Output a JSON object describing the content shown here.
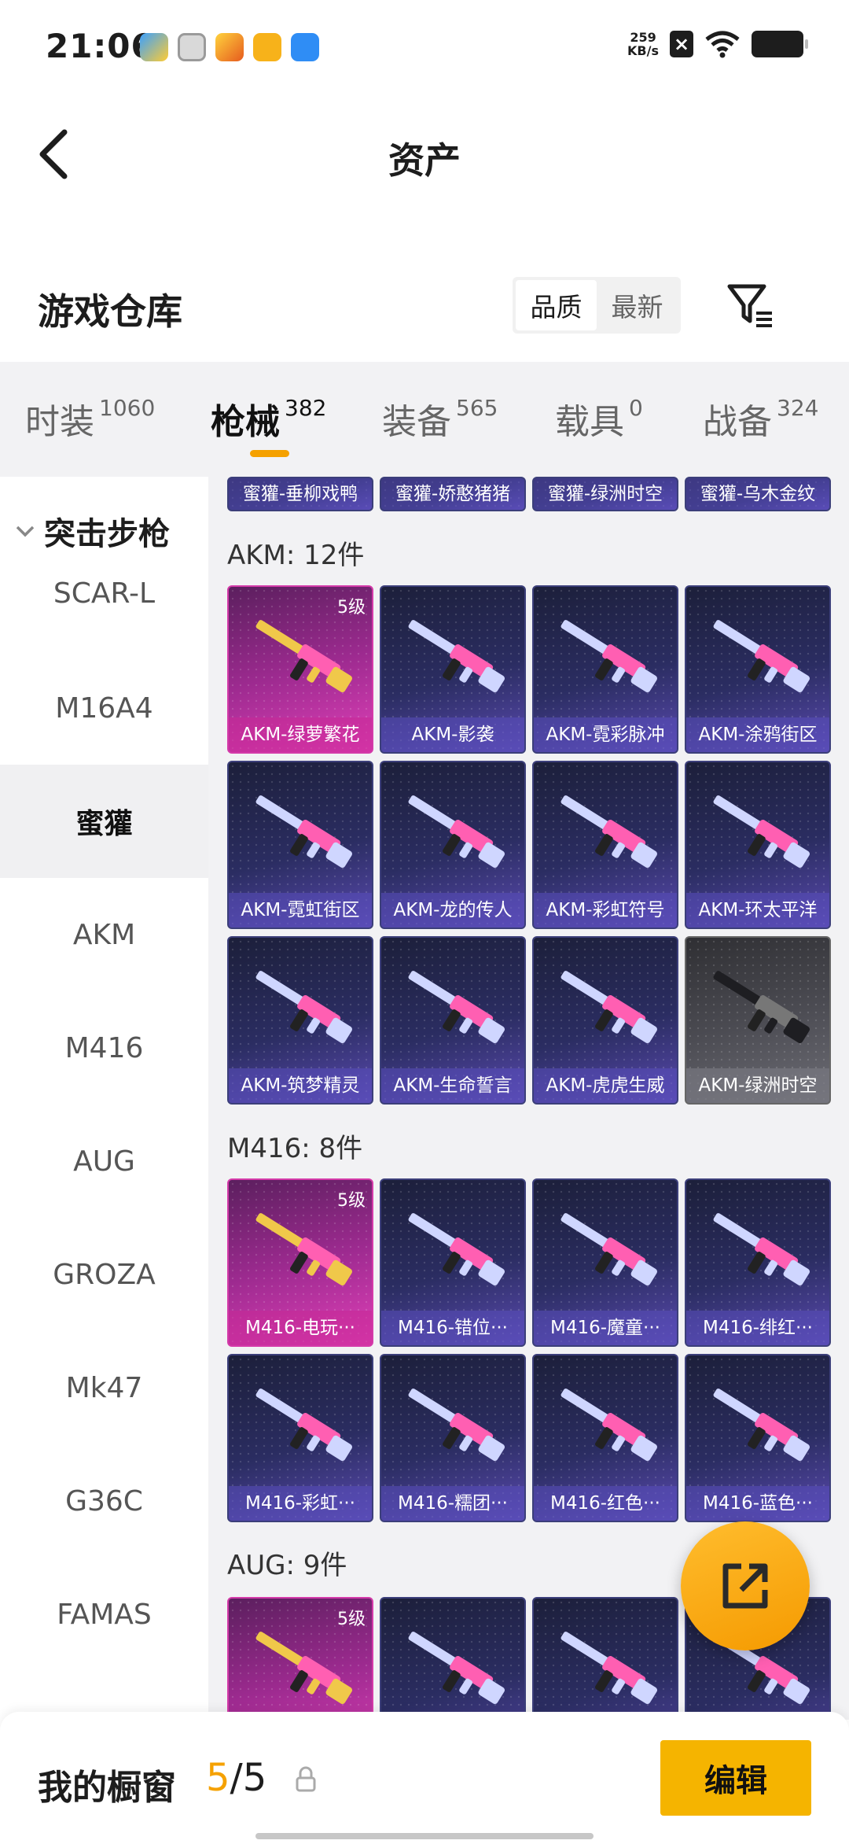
{
  "status_bar": {
    "time": "21:06",
    "speed_value": "259",
    "speed_unit": "KB/s",
    "app_icons": [
      "blue-app-icon",
      "gear-app-icon",
      "game-app-icon",
      "target-app-icon",
      "blue-bird-app-icon"
    ],
    "x_icon": "×"
  },
  "header": {
    "title": "资产",
    "back_icon": "back-arrow-icon"
  },
  "warehouse": {
    "title": "游戏仓库",
    "sort_options": [
      "品质",
      "最新"
    ],
    "sort_active": "品质",
    "filter_icon": "filter-icon"
  },
  "category_tabs": [
    {
      "label": "时装",
      "count": "1060"
    },
    {
      "label": "枪械",
      "count": "382",
      "active": true
    },
    {
      "label": "装备",
      "count": "565"
    },
    {
      "label": "载具",
      "count": "0"
    },
    {
      "label": "战备",
      "count": "324"
    }
  ],
  "sidebar": {
    "group": "突击步枪",
    "items": [
      "SCAR-L",
      "M16A4",
      "蜜獾",
      "AKM",
      "M416",
      "AUG",
      "GROZA",
      "Mk47",
      "G36C",
      "FAMAS"
    ],
    "active": "蜜獾"
  },
  "sections": {
    "top_row": [
      "蜜獾-垂柳戏鸭",
      "蜜獾-娇憨猪猪",
      "蜜獾-绿洲时空",
      "蜜獾-乌木金纹"
    ],
    "akm_title": "AKM: 12件",
    "akm": [
      {
        "name": "AKM-绿萝繁花",
        "level": "5级",
        "tier": "gold"
      },
      {
        "name": "AKM-影袭"
      },
      {
        "name": "AKM-霓彩脉冲"
      },
      {
        "name": "AKM-涂鸦街区"
      },
      {
        "name": "AKM-霓虹街区"
      },
      {
        "name": "AKM-龙的传人"
      },
      {
        "name": "AKM-彩虹符号"
      },
      {
        "name": "AKM-环太平洋"
      },
      {
        "name": "AKM-筑梦精灵"
      },
      {
        "name": "AKM-生命誓言"
      },
      {
        "name": "AKM-虎虎生威"
      },
      {
        "name": "AKM-绿洲时空",
        "tier": "grey"
      }
    ],
    "m416_title": "M416: 8件",
    "m416": [
      {
        "name": "M416-电玩···",
        "level": "5级",
        "tier": "gold"
      },
      {
        "name": "M416-错位···"
      },
      {
        "name": "M416-魔童···"
      },
      {
        "name": "M416-绯红···"
      },
      {
        "name": "M416-彩虹···"
      },
      {
        "name": "M416-糯团···"
      },
      {
        "name": "M416-红色···"
      },
      {
        "name": "M416-蓝色···"
      }
    ],
    "aug_title": "AUG: 9件",
    "aug_level": "5级"
  },
  "fab": {
    "icon": "share-external-icon"
  },
  "bottom_bar": {
    "label": "我的橱窗",
    "current": "5",
    "separator": "/",
    "total": "5",
    "lock_icon": "lock-icon",
    "edit_label": "编辑"
  },
  "colors": {
    "accent": "#f5a100",
    "edit_button": "#f5b400",
    "card_default": "#2b2d62",
    "card_gold": "#d43aa9",
    "card_grey": "#4b4b52"
  }
}
